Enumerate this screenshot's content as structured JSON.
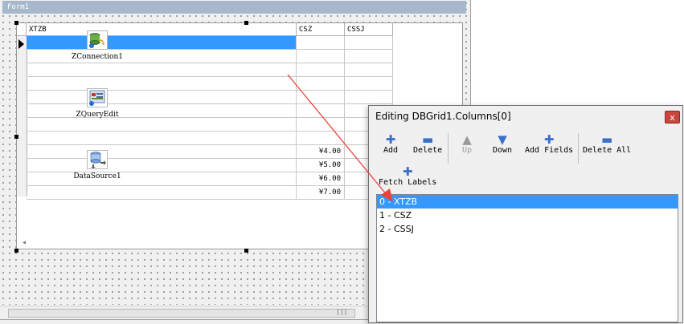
{
  "form": {
    "caption": "Form1",
    "grid": {
      "columns": [
        "XTZB",
        "CSZ",
        "CSSJ"
      ],
      "rows": [
        {
          "xtzb": "",
          "csz": "",
          "cssj": ""
        },
        {
          "xtzb": "",
          "csz": "",
          "cssj": ""
        },
        {
          "xtzb": "",
          "csz": "",
          "cssj": ""
        },
        {
          "xtzb": "",
          "csz": "",
          "cssj": ""
        },
        {
          "xtzb": "",
          "csz": "",
          "cssj": ""
        },
        {
          "xtzb": "",
          "csz": "",
          "cssj": ""
        },
        {
          "xtzb": "",
          "csz": "",
          "cssj": ""
        },
        {
          "xtzb": "",
          "csz": "",
          "cssj": ""
        },
        {
          "xtzb": "",
          "csz": "¥4.00",
          "cssj": ""
        },
        {
          "xtzb": "",
          "csz": "¥5.00",
          "cssj": ""
        },
        {
          "xtzb": "",
          "csz": "¥6.00",
          "cssj": ""
        },
        {
          "xtzb": "",
          "csz": "¥7.00",
          "cssj": ""
        }
      ]
    },
    "components": {
      "connection": "ZConnection1",
      "query": "ZQueryEdit",
      "datasource": "DataSource1"
    },
    "scroll_grip": "|||"
  },
  "editor": {
    "title": "Editing DBGrid1.Columns[0]",
    "close_label": "x",
    "toolbar": {
      "add": "Add",
      "delete": "Delete",
      "up": "Up",
      "down": "Down",
      "add_fields": "Add Fields",
      "delete_all": "Delete All",
      "fetch_labels": "Fetch Labels"
    },
    "columns": [
      "0 - XTZB",
      "1 - CSZ",
      "2 - CSSJ"
    ],
    "selected_index": 0
  },
  "colors": {
    "selection": "#3399ff",
    "caption_bar": "#a8b8cc",
    "annotation_arrow": "#e8443a"
  },
  "icons": {
    "add": "plus-icon",
    "delete": "minus-icon",
    "up": "arrow-up-icon",
    "down": "arrow-down-icon",
    "close": "close-icon"
  }
}
